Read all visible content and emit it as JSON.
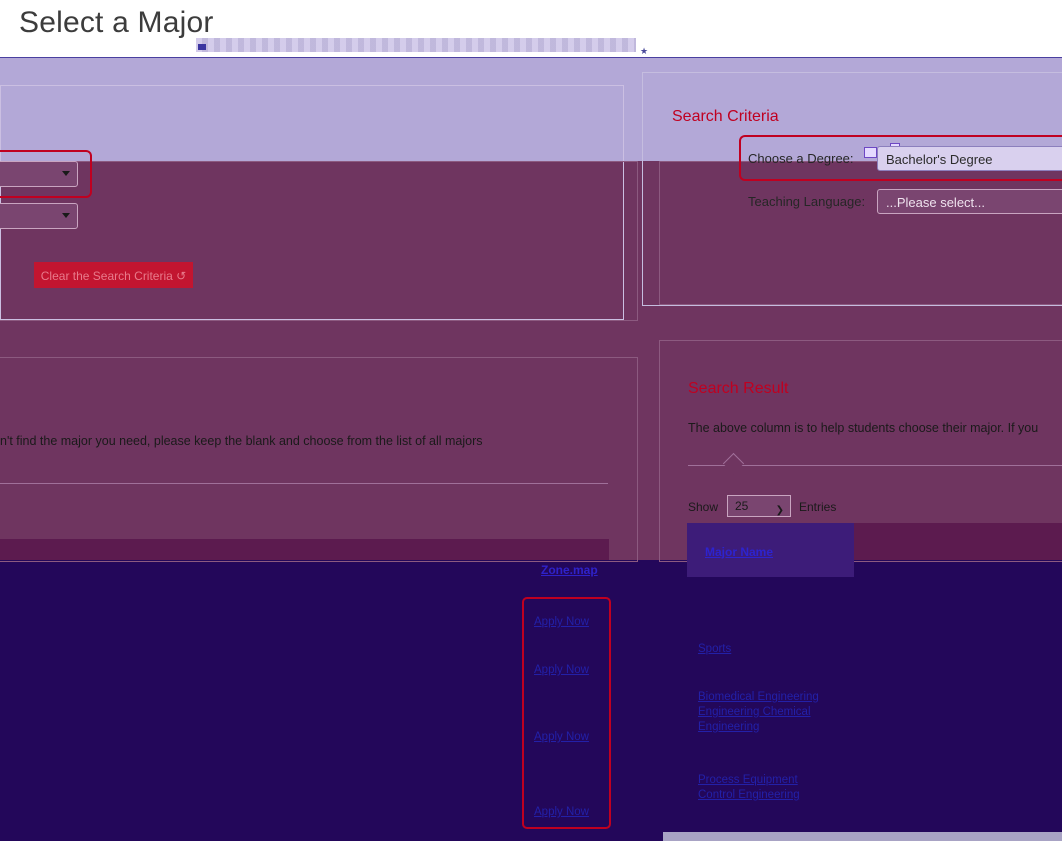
{
  "page": {
    "title": "Select a Major"
  },
  "left": {
    "clear_button": "Clear the Search Criteria ↺",
    "info_text": "n't find the major you need, please keep the blank and choose from the list of all majors",
    "zone_link": "Zone.map",
    "row_links": [
      "Apply Now",
      "Apply Now",
      "Apply Now",
      "Apply Now"
    ]
  },
  "right": {
    "criteria_heading": "Search Criteria",
    "choose_degree_label": "Choose a Degree:",
    "degree_value": "Bachelor's Degree",
    "teaching_language_label": "Teaching Language:",
    "teaching_language_placeholder": "...Please select...",
    "result_heading": "Search Result",
    "result_info": "The above column is to help students choose their major. If you",
    "show_label": "Show",
    "entries_value": "25",
    "entries_label": "Entries",
    "major_name_header": "Major Name",
    "majors": [
      "Sports",
      "Biomedical Engineering  Engineering  Chemical Engineering",
      "Process Equipment Control Engineering"
    ]
  }
}
